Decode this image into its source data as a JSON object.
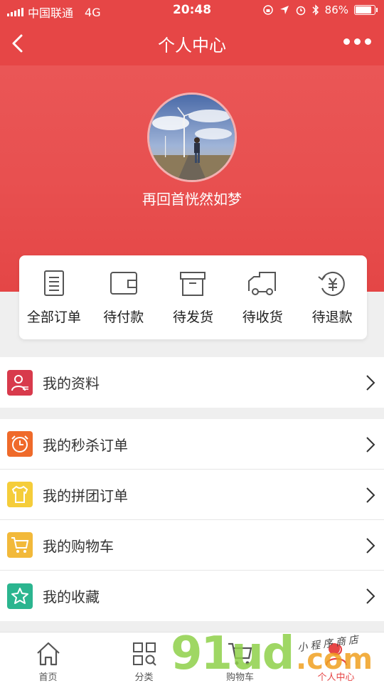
{
  "status_bar": {
    "carrier": "中国联通",
    "network": "4G",
    "time": "20:48",
    "battery": "86%"
  },
  "header": {
    "title": "个人中心"
  },
  "profile": {
    "username": "再回首恍然如梦"
  },
  "orders": [
    {
      "label": "全部订单",
      "icon": "order-list-icon"
    },
    {
      "label": "待付款",
      "icon": "wallet-icon"
    },
    {
      "label": "待发货",
      "icon": "box-icon"
    },
    {
      "label": "待收货",
      "icon": "truck-icon"
    },
    {
      "label": "待退款",
      "icon": "refund-icon"
    }
  ],
  "menu_profile": [
    {
      "label": "我的资料",
      "icon": "profile-icon",
      "color": "#d83a4c"
    }
  ],
  "menu_main": [
    {
      "label": "我的秒杀订单",
      "icon": "alarm-clock-icon",
      "color": "#ef6a2a"
    },
    {
      "label": "我的拼团订单",
      "icon": "shirt-icon",
      "color": "#f5cd3a"
    },
    {
      "label": "我的购物车",
      "icon": "cart-icon",
      "color": "#f2b93a"
    },
    {
      "label": "我的收藏",
      "icon": "star-icon",
      "color": "#2bb58f"
    }
  ],
  "tabbar": [
    {
      "label": "首页",
      "icon": "home-icon"
    },
    {
      "label": "分类",
      "icon": "category-icon"
    },
    {
      "label": "购物车",
      "icon": "cart-tab-icon"
    },
    {
      "label": "个人中心",
      "icon": "person-tab-icon",
      "active": true
    }
  ],
  "watermark": {
    "main": "91ud",
    "suffix": ".com",
    "tagline": "小程序商店"
  },
  "colors": {
    "brand": "#e64646"
  }
}
